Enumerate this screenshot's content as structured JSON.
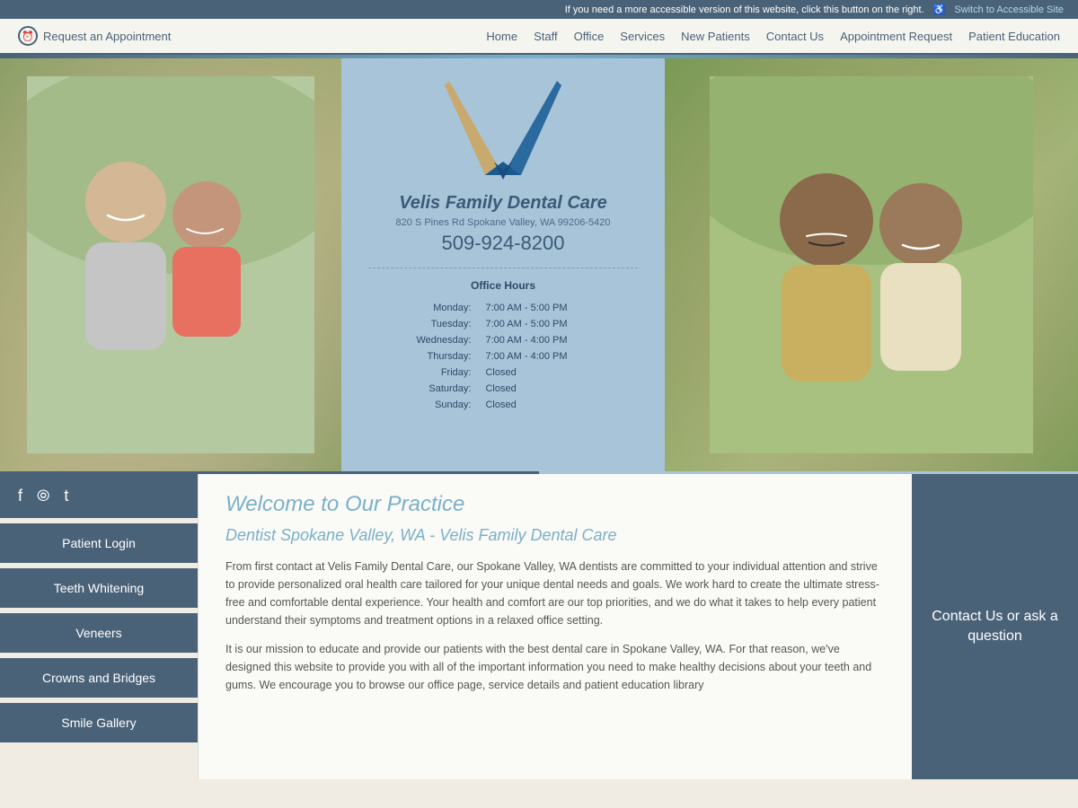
{
  "accessibility_bar": {
    "message": "If you need a more accessible version of this website, click this button on the right.",
    "link_label": "Switch to Accessible Site",
    "icon": "♿"
  },
  "header": {
    "request_label": "Request an Appointment",
    "nav": [
      {
        "label": "Home",
        "href": "#"
      },
      {
        "label": "Staff",
        "href": "#"
      },
      {
        "label": "Office",
        "href": "#"
      },
      {
        "label": "Services",
        "href": "#"
      },
      {
        "label": "New Patients",
        "href": "#"
      },
      {
        "label": "Contact Us",
        "href": "#"
      },
      {
        "label": "Appointment Request",
        "href": "#"
      },
      {
        "label": "Patient Education",
        "href": "#"
      }
    ]
  },
  "hero": {
    "practice_name": "Velis Family Dental Care",
    "address": "820 S Pines Rd Spokane Valley, WA 99206-5420",
    "phone": "509-924-8200",
    "office_hours_title": "Office Hours",
    "hours": [
      {
        "day": "Monday:",
        "time": "7:00 AM - 5:00 PM"
      },
      {
        "day": "Tuesday:",
        "time": "7:00 AM - 5:00 PM"
      },
      {
        "day": "Wednesday:",
        "time": "7:00 AM - 4:00 PM"
      },
      {
        "day": "Thursday:",
        "time": "7:00 AM - 4:00 PM"
      },
      {
        "day": "Friday:",
        "time": "Closed"
      },
      {
        "day": "Saturday:",
        "time": "Closed"
      },
      {
        "day": "Sunday:",
        "time": "Closed"
      }
    ]
  },
  "sidebar": {
    "social_icons": [
      "f",
      "rss",
      "twitter"
    ],
    "buttons": [
      {
        "label": "Patient Login",
        "name": "patient-login-btn"
      },
      {
        "label": "Teeth Whitening",
        "name": "teeth-whitening-btn"
      },
      {
        "label": "Veneers",
        "name": "veneers-btn"
      },
      {
        "label": "Crowns and Bridges",
        "name": "crowns-bridges-btn"
      },
      {
        "label": "Smile Gallery",
        "name": "smile-gallery-btn"
      }
    ]
  },
  "cta": {
    "text": "Contact Us or ask a question"
  },
  "main": {
    "welcome_heading": "Welcome to Our Practice",
    "subheading": "Dentist Spokane Valley, WA - Velis Family Dental Care",
    "paragraph1": "From first contact at Velis Family Dental Care, our Spokane Valley, WA dentists are committed to your individual attention and strive to provide personalized oral health care tailored for your unique dental needs and goals. We work hard to create the ultimate stress-free and comfortable dental experience. Your health and comfort are our top priorities, and we do what it takes to help every patient understand their symptoms and treatment options in a relaxed office setting.",
    "paragraph2": "It is our mission to educate and provide our patients with the best dental care in Spokane Valley, WA. For that reason, we've designed this website to provide you with all of the important information you need to make healthy decisions about your teeth and gums. We encourage you to browse our office page, service details and patient education library"
  }
}
